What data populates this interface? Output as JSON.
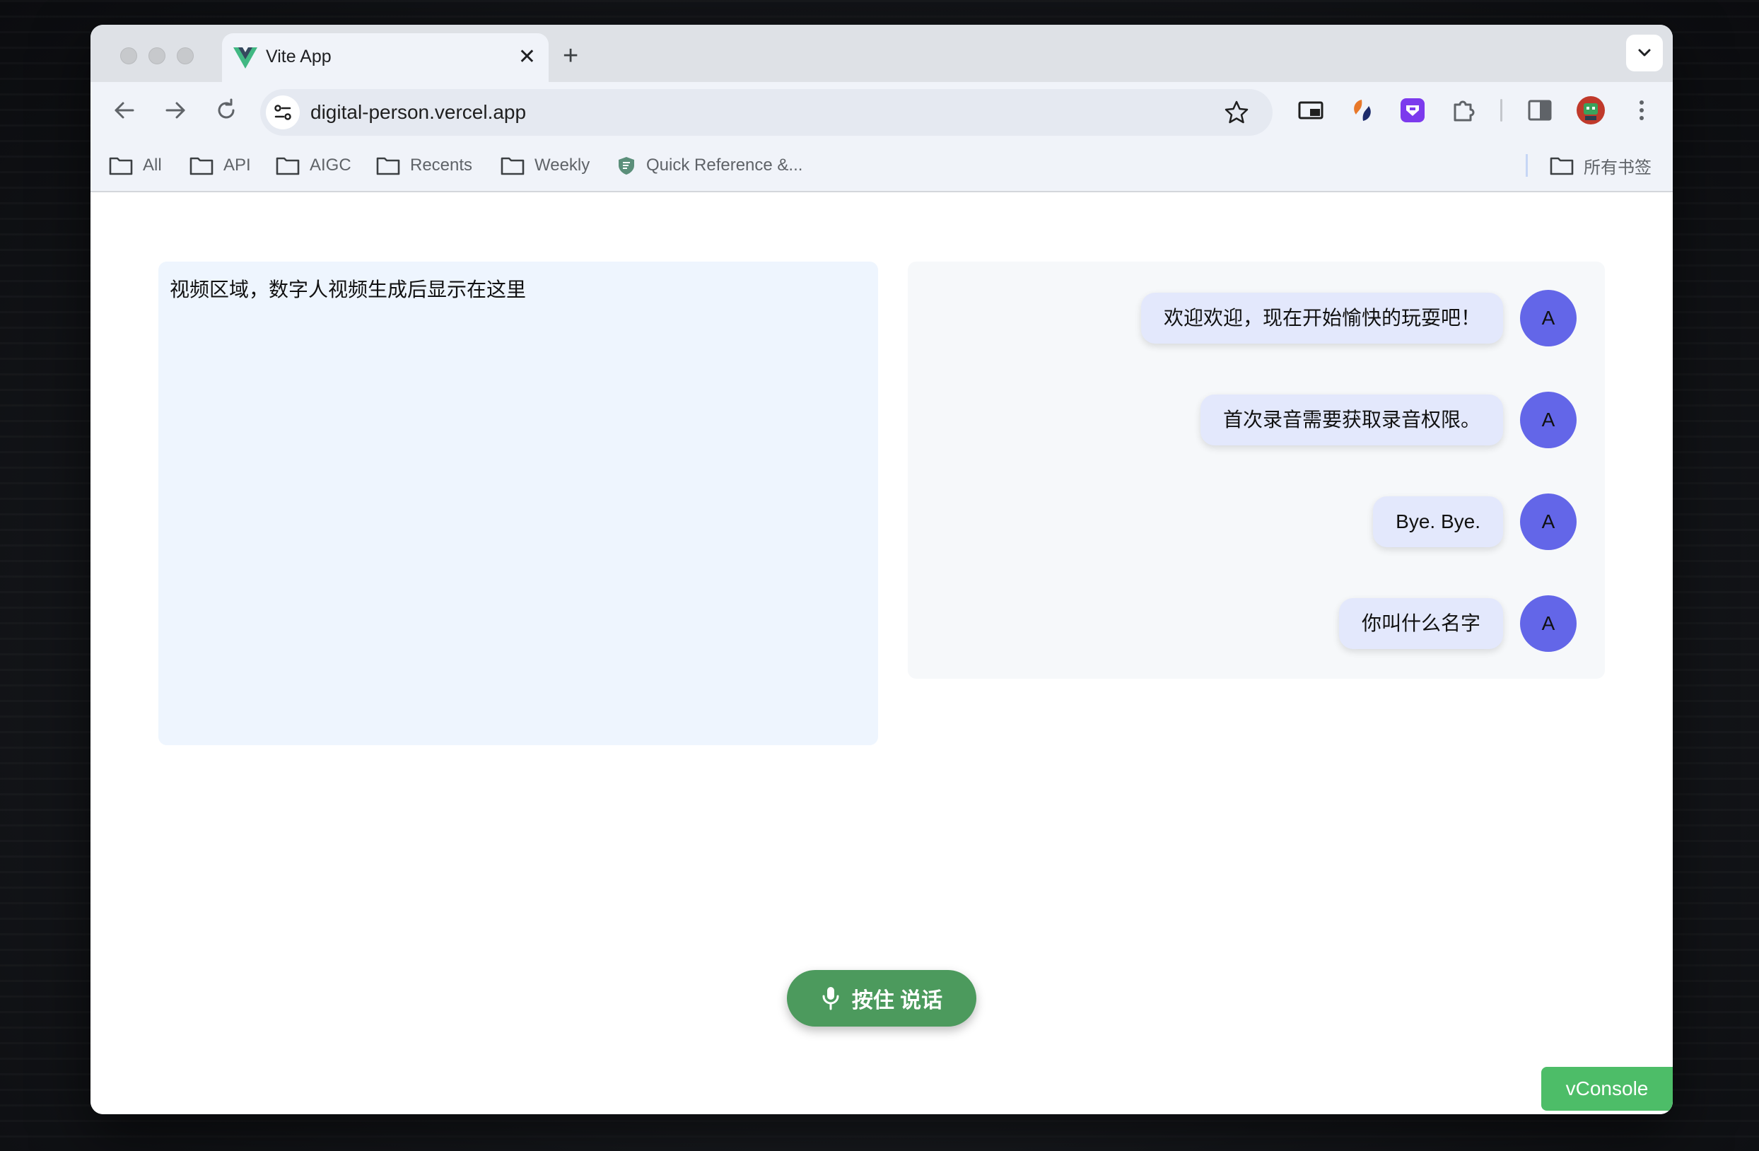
{
  "browser": {
    "tab": {
      "title": "Vite App",
      "close_glyph": "✕",
      "favicon": "vue-logo-icon"
    },
    "new_tab_glyph": "+",
    "address_bar": {
      "url": "digital-person.vercel.app"
    },
    "bookmarks": [
      {
        "label": "All",
        "icon": "folder-icon"
      },
      {
        "label": "API",
        "icon": "folder-icon"
      },
      {
        "label": "AIGC",
        "icon": "folder-icon"
      },
      {
        "label": "Recents",
        "icon": "folder-icon"
      },
      {
        "label": "Weekly",
        "icon": "folder-icon"
      },
      {
        "label": "Quick Reference &...",
        "icon": "site-favicon-icon"
      }
    ],
    "all_bookmarks_label": "所有书签"
  },
  "page": {
    "video_placeholder": "视频区域，数字人视频生成后显示在这里",
    "messages": [
      {
        "text": "欢迎欢迎，现在开始愉快的玩耍吧！",
        "avatar": "A"
      },
      {
        "text": "首次录音需要获取录音权限。",
        "avatar": "A"
      },
      {
        "text": "Bye. Bye.",
        "avatar": "A"
      },
      {
        "text": "你叫什么名字",
        "avatar": "A"
      }
    ],
    "talk_button_label": "按住 说话",
    "vconsole_label": "vConsole"
  },
  "colors": {
    "talk_button": "#4c9a5d",
    "avatar": "#6366e8",
    "bubble": "#e3e8fc",
    "vconsole": "#4dbd68",
    "video_area": "#eef5fe"
  }
}
